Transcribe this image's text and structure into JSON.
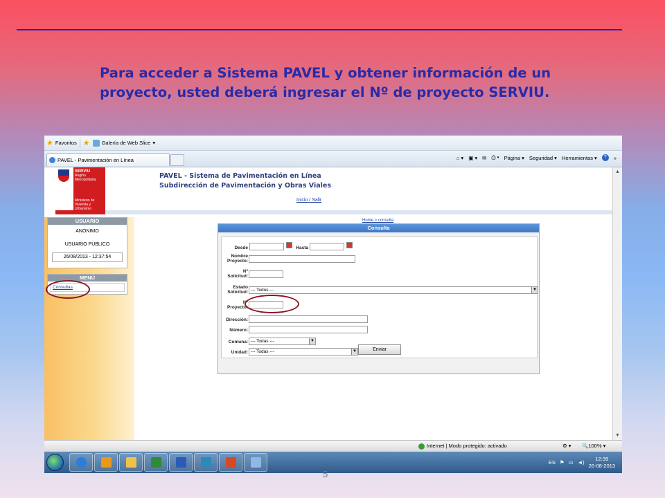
{
  "slide": {
    "title": "Para acceder a Sistema PAVEL y obtener información  de un proyecto, usted deberá  ingresar el Nº de proyecto SERVIU.",
    "page_number": "5",
    "rule_color": "#1f1fc8",
    "title_color": "#2a2aa8"
  },
  "browser": {
    "favorites_label": "Favoritos",
    "web_slice_label": "Galería de Web Slice",
    "tab_title": "PAVEL - Pavimentación en Línea",
    "cmd": {
      "page": "Página",
      "security": "Seguridad",
      "tools": "Herramientas"
    },
    "status_zone": "Internet | Modo protegido: activado",
    "zoom": "100%"
  },
  "site": {
    "logo_text": "SERVIU",
    "logo_sub": "Región Metropolitana",
    "ministry": "Ministerio de Vivienda y Urbanismo",
    "title_line1": "PAVEL - Sistema de Pavimentación en Línea",
    "title_line2": "Subdirección de Pavimentación y Obras Viales",
    "link_inicio": "Inicio",
    "link_sep": "/",
    "link_salir": "Salir",
    "breadcrumb": "Home > consulta"
  },
  "sidebar": {
    "user_header": "USUARIO",
    "user_anon": "ANÓNIMO",
    "user_public": "USUARIO PÚBLICO",
    "datetime": "26/08/2013 - 12:37:54",
    "menu_header": "MENÚ",
    "menu_item": "Consultas"
  },
  "form": {
    "header": "Consulta",
    "desde": "Desde",
    "hasta": "Hasta",
    "nombre_proyecto": [
      "Nombre",
      "Proyecto:"
    ],
    "n_solicitud": [
      "Nº",
      "Solicitud:"
    ],
    "estado_solicitud": [
      "Estado",
      "Solicitud:"
    ],
    "estado_value": "--- Todos ---",
    "n_proyecto": [
      "Nº",
      "Proyecto:"
    ],
    "direccion": "Dirección:",
    "numero": "Número:",
    "comuna": "Comuna:",
    "comuna_value": "--- Todas ---",
    "unidad": "Unidad:",
    "unidad_value": "--- Todas ---",
    "submit": "Enviar"
  },
  "taskbar": {
    "lang": "ES",
    "time": "12:39",
    "date": "26-08-2013"
  }
}
